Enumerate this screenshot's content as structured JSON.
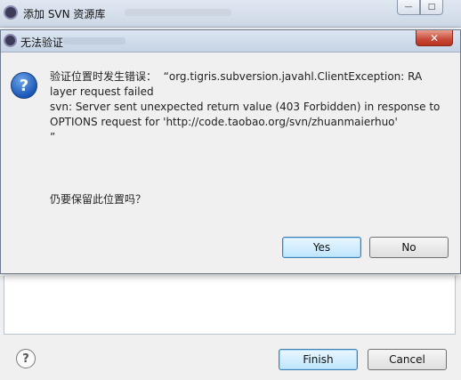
{
  "back_window": {
    "title": "添加 SVN 资源库",
    "controls": {
      "minimize": "—",
      "maximize": "□",
      "close": "✕"
    },
    "buttons": {
      "finish": "Finish",
      "cancel": "Cancel"
    },
    "help": "?"
  },
  "dialog": {
    "title": "无法验证",
    "close": "✕",
    "icon": "question-icon",
    "message": "验证位置时发生错误：  “org.tigris.subversion.javahl.ClientException: RA layer request failed\nsvn: Server sent unexpected return value (403 Forbidden) in response to OPTIONS request for 'http://code.taobao.org/svn/zhuanmaierhuo'\n”",
    "question": "仍要保留此位置吗？",
    "yes": "Yes",
    "no": "No"
  }
}
